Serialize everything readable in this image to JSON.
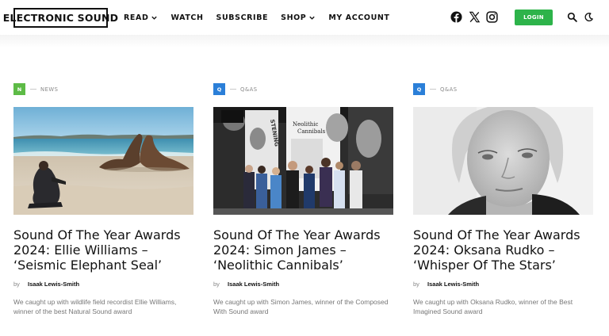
{
  "header": {
    "logo": "ELECTRONIC SOUND",
    "nav": [
      {
        "label": "READ",
        "dropdown": true
      },
      {
        "label": "WATCH",
        "dropdown": false
      },
      {
        "label": "SUBSCRIBE",
        "dropdown": false
      },
      {
        "label": "SHOP",
        "dropdown": true
      },
      {
        "label": "MY ACCOUNT",
        "dropdown": false
      }
    ],
    "social_icons": [
      "facebook-icon",
      "x-icon",
      "instagram-icon"
    ],
    "login_label": "LOGIN",
    "tool_icons": [
      "search-icon",
      "dark-mode-icon"
    ]
  },
  "colors": {
    "login": "#2db34a",
    "news_badge": "#5dbb46",
    "qa_badge": "#2b7fd8"
  },
  "articles": [
    {
      "badge": "N",
      "category": "NEWS",
      "title": "Sound Of The Year Awards 2024: Ellie Williams – ‘Seismic Elephant Seal’",
      "by": "by",
      "author": "Isaak Lewis-Smith",
      "excerpt": "We caught up with wildlife field recordist Ellie Williams, winner of the best Natural Sound award"
    },
    {
      "badge": "Q",
      "category": "Q&AS",
      "title": "Sound Of The Year Awards 2024: Simon James – ‘Neolithic Cannibals’",
      "by": "by",
      "author": "Isaak Lewis-Smith",
      "excerpt": "We caught up with Simon James, winner of the Composed With Sound award",
      "image_text": [
        "STENING",
        "Neolithic",
        "Cannibals"
      ]
    },
    {
      "badge": "Q",
      "category": "Q&AS",
      "title": "Sound Of The Year Awards 2024: Oksana Rudko – ‘Whisper Of The Stars’",
      "by": "by",
      "author": "Isaak Lewis-Smith",
      "excerpt": "We caught up with Oksana Rudko, winner of the Best Imagined Sound award"
    }
  ]
}
